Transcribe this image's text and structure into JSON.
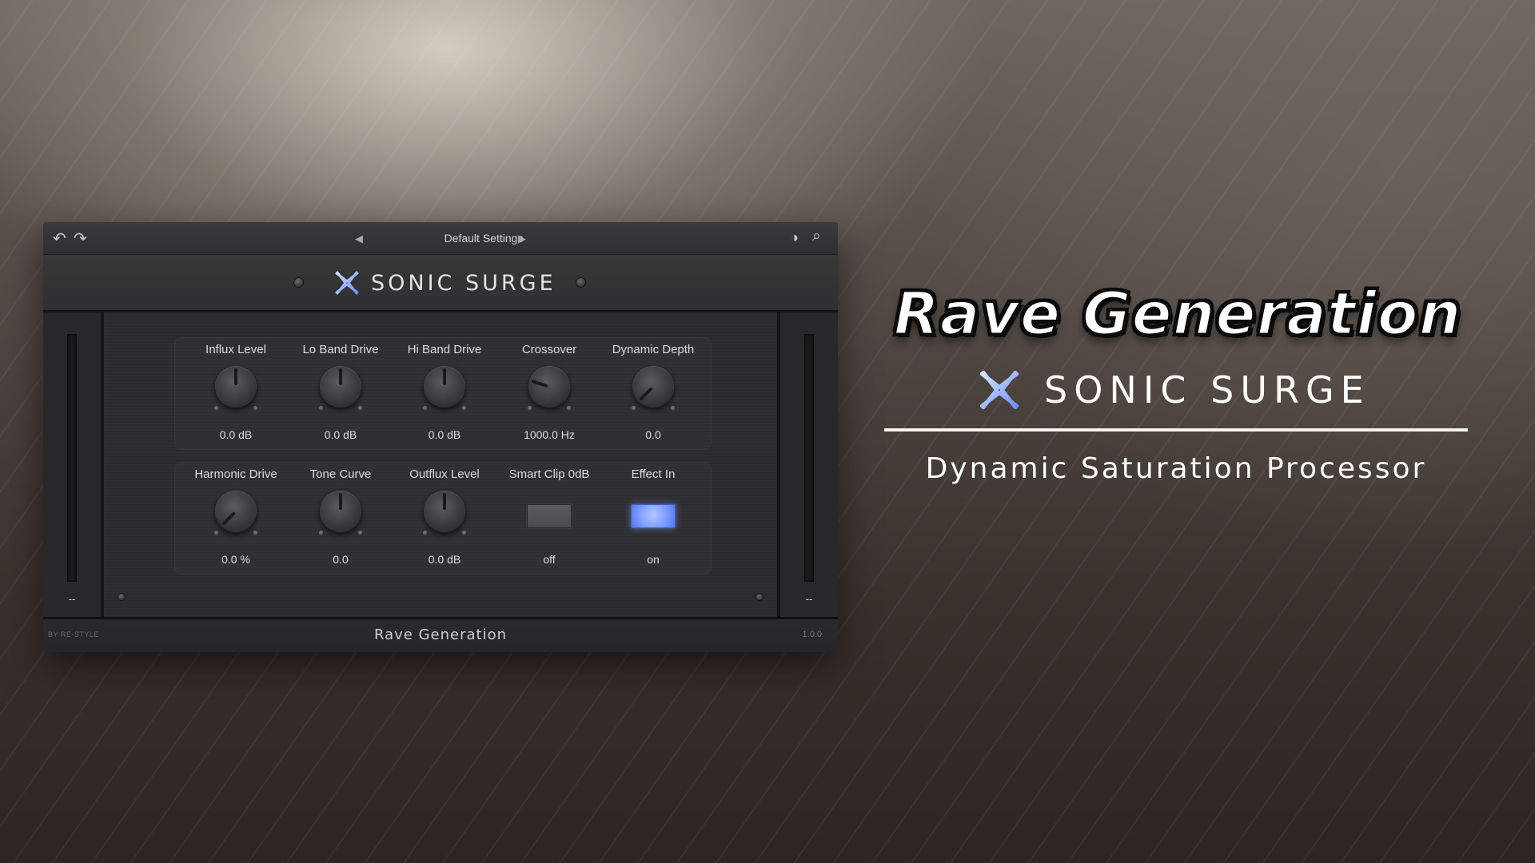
{
  "plugin": {
    "toolbar": {
      "undo_icon": "↶",
      "redo_icon": "↷",
      "prev_icon": "◀",
      "next_icon": "▶",
      "preset_name": "Default Settings",
      "theme_icon": "◑",
      "search_icon": "⌕"
    },
    "header": {
      "title": "SONIC SURGE"
    },
    "meters": {
      "left_readout": "--",
      "right_readout": "--"
    },
    "row1": [
      {
        "label": "Influx Level",
        "value": "0.0 dB"
      },
      {
        "label": "Lo Band Drive",
        "value": "0.0 dB"
      },
      {
        "label": "Hi Band Drive",
        "value": "0.0 dB"
      },
      {
        "label": "Crossover",
        "value": "1000.0 Hz"
      },
      {
        "label": "Dynamic Depth",
        "value": "0.0"
      }
    ],
    "row2": [
      {
        "label": "Harmonic Drive",
        "value": "0.0 %"
      },
      {
        "label": "Tone Curve",
        "value": "0.0"
      },
      {
        "label": "Outflux Level",
        "value": "0.0 dB"
      },
      {
        "label": "Smart Clip 0dB",
        "value": "off"
      },
      {
        "label": "Effect In",
        "value": "on"
      }
    ],
    "footer": {
      "left": "BY RE-STYLE",
      "center": "Rave Generation",
      "right": "1.0.0"
    }
  },
  "branding": {
    "title": "Rave Generation",
    "product": "SONIC SURGE",
    "subtitle": "Dynamic Saturation Processor"
  },
  "colors": {
    "toggle_on": "#7a9cff",
    "logo_blue": "#8fb0ff"
  }
}
